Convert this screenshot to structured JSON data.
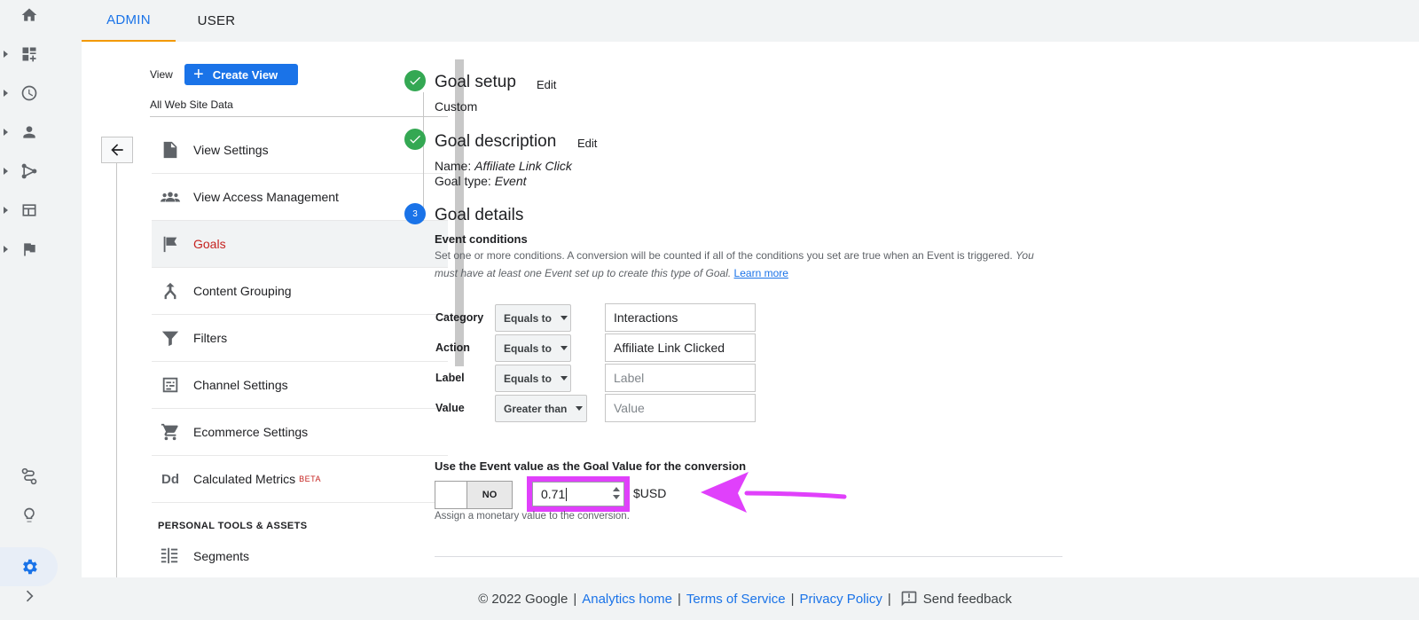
{
  "tabs": {
    "admin": "ADMIN",
    "user": "USER"
  },
  "view": {
    "label": "View",
    "create_button": "Create View",
    "name": "All Web Site Data"
  },
  "menu": {
    "items": [
      {
        "label": "View Settings",
        "icon": "document-icon"
      },
      {
        "label": "View Access Management",
        "icon": "people-icon"
      },
      {
        "label": "Goals",
        "icon": "flag-icon",
        "active": true
      },
      {
        "label": "Content Grouping",
        "icon": "grouping-icon"
      },
      {
        "label": "Filters",
        "icon": "filter-icon"
      },
      {
        "label": "Channel Settings",
        "icon": "channel-icon"
      },
      {
        "label": "Ecommerce Settings",
        "icon": "cart-icon"
      },
      {
        "label": "Calculated Metrics",
        "icon": "dd-icon",
        "badge": "BETA"
      }
    ],
    "section_title": "PERSONAL TOOLS & ASSETS",
    "segments_label": "Segments"
  },
  "steps": {
    "setup": {
      "title": "Goal setup",
      "edit": "Edit",
      "value": "Custom"
    },
    "description": {
      "title": "Goal description",
      "edit": "Edit",
      "name_label": "Name:",
      "name_value": "Affiliate Link Click",
      "type_label": "Goal type:",
      "type_value": "Event"
    },
    "details": {
      "number": "3",
      "title": "Goal details"
    }
  },
  "event_conditions": {
    "heading": "Event conditions",
    "desc_plain": "Set one or more conditions. A conversion will be counted if all of the conditions you set are true when an Event is triggered.",
    "desc_italic": "You must have at least one Event set up to create this type of Goal.",
    "learn_more": "Learn more",
    "rows": [
      {
        "label": "Category",
        "operator": "Equals to",
        "value": "Interactions",
        "placeholder": ""
      },
      {
        "label": "Action",
        "operator": "Equals to",
        "value": "Affiliate Link Clicked",
        "placeholder": ""
      },
      {
        "label": "Label",
        "operator": "Equals to",
        "value": "",
        "placeholder": "Label"
      },
      {
        "label": "Value",
        "operator": "Greater than",
        "value": "",
        "placeholder": "Value"
      }
    ]
  },
  "goal_value": {
    "heading": "Use the Event value as the Goal Value for the conversion",
    "toggle": "NO",
    "amount": "0.71",
    "currency": "$USD",
    "hint": "Assign a monetary value to the conversion."
  },
  "footer": {
    "copyright": "© 2022 Google",
    "analytics_home": "Analytics home",
    "terms": "Terms of Service",
    "privacy": "Privacy Policy",
    "feedback": "Send feedback"
  },
  "colors": {
    "accent": "#1a73e8",
    "success": "#34a853",
    "active": "#c5221f",
    "highlight": "#e040fb"
  }
}
